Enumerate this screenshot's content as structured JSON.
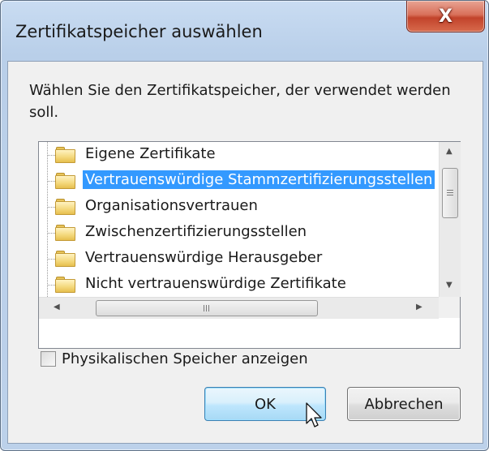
{
  "window": {
    "title": "Zertifikatspeicher auswählen",
    "close_icon": "close-icon",
    "close_glyph": "X"
  },
  "prompt": "Wählen Sie den Zertifikatspeicher, der verwendet werden soll.",
  "tree": {
    "items": [
      {
        "label": "Eigene Zertifikate",
        "icon": "folder-icon",
        "selected": false
      },
      {
        "label": "Vertrauenswürdige Stammzertifizierungsstellen",
        "icon": "folder-icon",
        "selected": true
      },
      {
        "label": "Organisationsvertrauen",
        "icon": "folder-icon",
        "selected": false
      },
      {
        "label": "Zwischenzertifizierungsstellen",
        "icon": "folder-icon",
        "selected": false
      },
      {
        "label": "Vertrauenswürdige Herausgeber",
        "icon": "folder-icon",
        "selected": false
      },
      {
        "label": "Nicht vertrauenswürdige Zertifikate",
        "icon": "folder-icon",
        "selected": false
      }
    ]
  },
  "checkbox": {
    "label": "Physikalischen Speicher anzeigen",
    "checked": false
  },
  "buttons": {
    "ok": "OK",
    "cancel": "Abbrechen"
  },
  "colors": {
    "selection": "#3399ff",
    "close_button": "#c2432b",
    "default_button_border": "#3c7fb1"
  }
}
